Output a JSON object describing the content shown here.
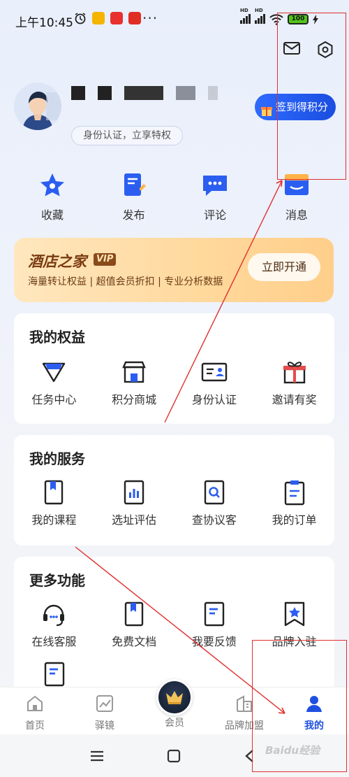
{
  "status_bar": {
    "time": "上午10:45",
    "dots": "···",
    "battery": "100",
    "hd1": "HD",
    "hd2": "HD"
  },
  "profile": {
    "verify_text": "身份认证，立享特权",
    "checkin_label": "签到得积分"
  },
  "quick_actions": [
    {
      "label": "收藏",
      "icon": "star-icon"
    },
    {
      "label": "发布",
      "icon": "edit-note-icon"
    },
    {
      "label": "评论",
      "icon": "chat-bubble-icon"
    },
    {
      "label": "消息",
      "icon": "inbox-icon"
    }
  ],
  "vip": {
    "title": "酒店之家",
    "badge": "VIP",
    "subtitle": "海量转让权益 | 超值会员折扣 | 专业分析数据",
    "button": "立即开通"
  },
  "sections": {
    "rights": {
      "title": "我的权益",
      "items": [
        {
          "label": "任务中心",
          "icon": "diamond-icon"
        },
        {
          "label": "积分商城",
          "icon": "store-icon"
        },
        {
          "label": "身份认证",
          "icon": "id-card-icon"
        },
        {
          "label": "邀请有奖",
          "icon": "gift-icon"
        }
      ]
    },
    "services": {
      "title": "我的服务",
      "items": [
        {
          "label": "我的课程",
          "icon": "book-icon"
        },
        {
          "label": "选址评估",
          "icon": "bar-chart-icon"
        },
        {
          "label": "查协议客",
          "icon": "search-doc-icon"
        },
        {
          "label": "我的订单",
          "icon": "clipboard-icon"
        }
      ]
    },
    "more": {
      "title": "更多功能",
      "items": [
        {
          "label": "在线客服",
          "icon": "headset-icon"
        },
        {
          "label": "免费文档",
          "icon": "bookmark-doc-icon"
        },
        {
          "label": "我要反馈",
          "icon": "feedback-doc-icon"
        },
        {
          "label": "品牌入驻",
          "icon": "star-badge-icon"
        }
      ]
    }
  },
  "bottom_nav": [
    {
      "label": "首页",
      "icon": "home-icon"
    },
    {
      "label": "驿镜",
      "icon": "trend-chart-icon"
    },
    {
      "label": "会员",
      "icon": "member-crown-icon"
    },
    {
      "label": "品牌加盟",
      "icon": "building-icon"
    },
    {
      "label": "我的",
      "icon": "person-icon",
      "active": true
    }
  ],
  "colors": {
    "accent": "#1e50e0",
    "annotation": "#e03030",
    "vip_gold": "#ffd89c"
  },
  "watermark": "Baidu经验"
}
